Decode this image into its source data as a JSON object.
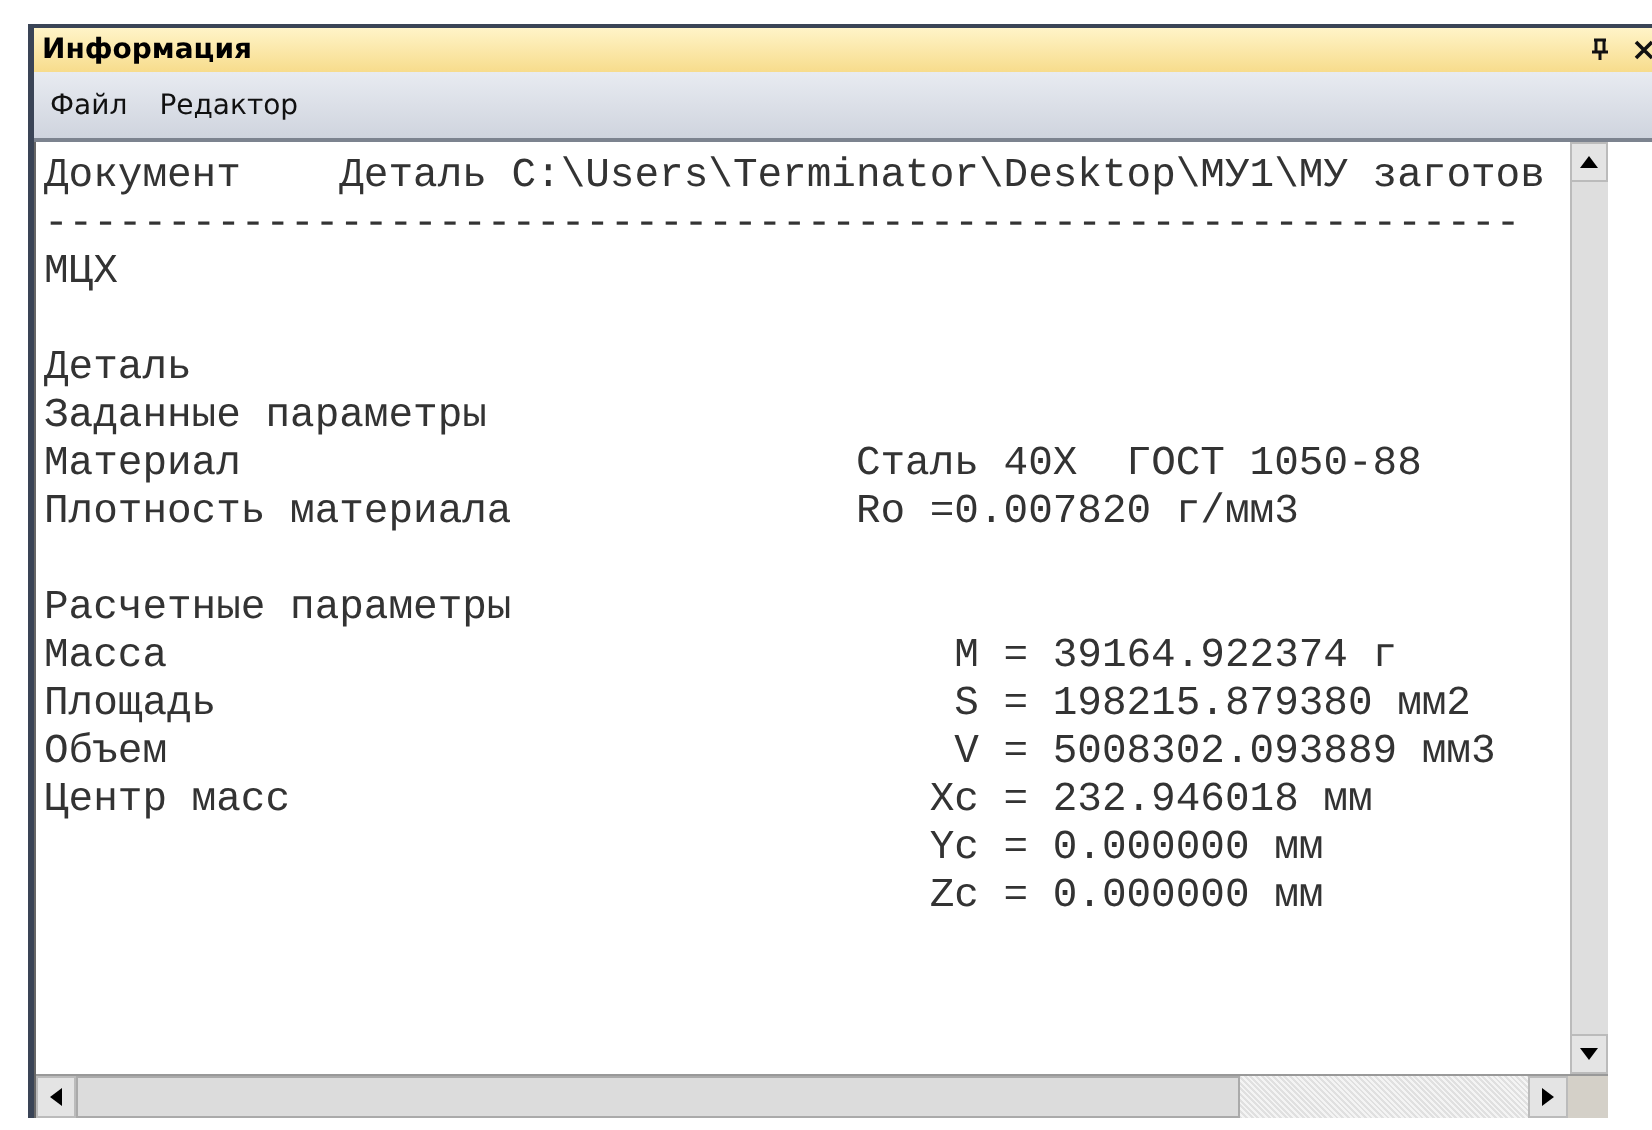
{
  "window": {
    "title": "Информация"
  },
  "menu": [
    "Файл",
    "Редактор"
  ],
  "document": {
    "label": "Документ",
    "value": "Деталь C:\\Users\\Terminator\\Desktop\\МУ1\\МУ заготов"
  },
  "separator": "------------------------------------------------------------",
  "lines": [
    {
      "kind": "text",
      "label": "МЦХ"
    },
    {
      "kind": "blank"
    },
    {
      "kind": "text",
      "label": "Деталь"
    },
    {
      "kind": "text",
      "label": "Заданные параметры"
    },
    {
      "kind": "pair",
      "label": "Материал",
      "value": "Сталь 40X  ГОСТ 1050-88"
    },
    {
      "kind": "pair",
      "label": "Плотность материала",
      "value": "Ro =0.007820 г/мм3"
    },
    {
      "kind": "blank"
    },
    {
      "kind": "text",
      "label": "Расчетные параметры"
    },
    {
      "kind": "formula",
      "label": "Масса",
      "symbol": "M",
      "value": "= 39164.922374 г"
    },
    {
      "kind": "formula",
      "label": "Площадь",
      "symbol": "S",
      "value": "= 198215.879380 мм2"
    },
    {
      "kind": "formula",
      "label": "Объем",
      "symbol": "V",
      "value": "= 5008302.093889 мм3"
    },
    {
      "kind": "formula",
      "label": "Центр масс",
      "symbol": "Xc",
      "value": "= 232.946018 мм"
    },
    {
      "kind": "formula",
      "symbol": "Yc",
      "value": "= 0.000000 мм"
    },
    {
      "kind": "formula",
      "symbol": "Zc",
      "value": "= 0.000000 мм"
    }
  ]
}
